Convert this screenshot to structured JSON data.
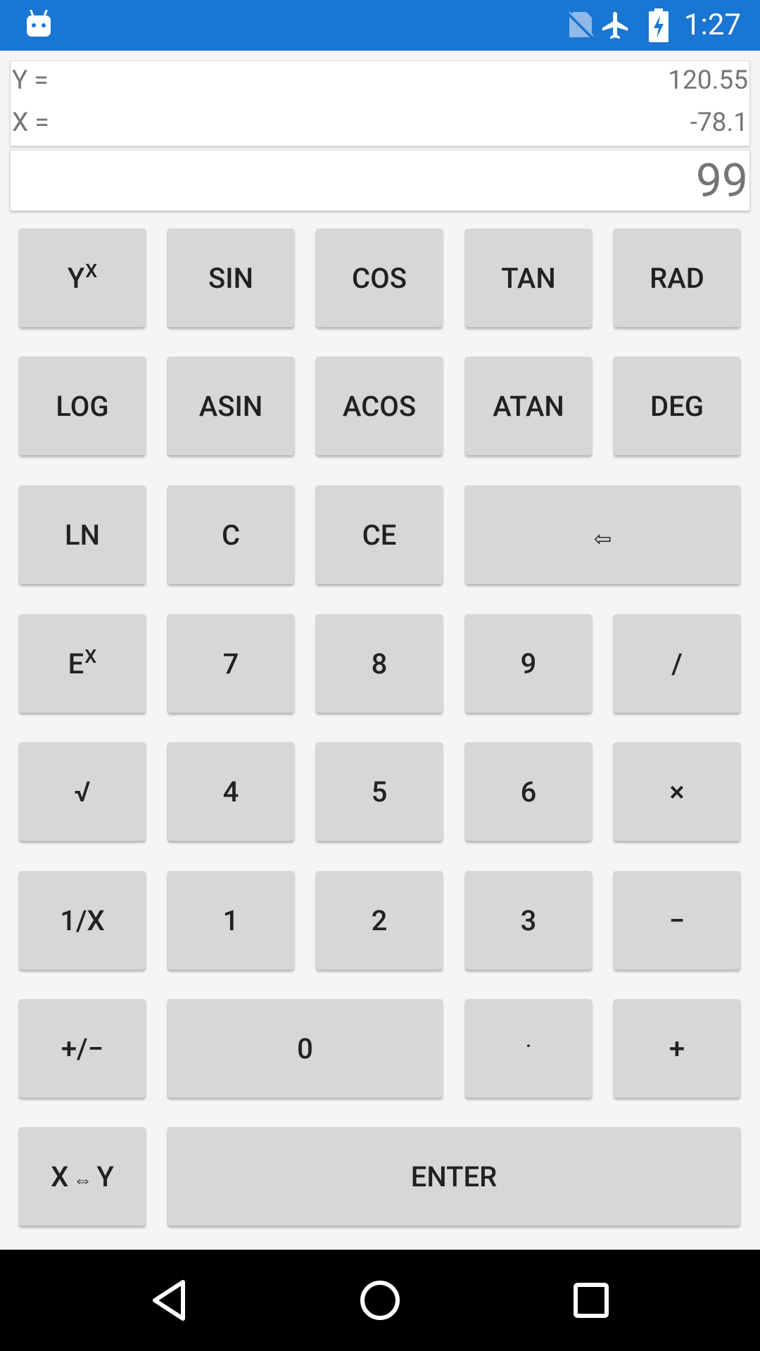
{
  "status_bar": {
    "time": "1:27",
    "icons": [
      "android-icon",
      "no-sim-icon",
      "airplane-mode-icon",
      "battery-charging-icon"
    ]
  },
  "registers": {
    "y_label": "Y =",
    "y_value": "120.55",
    "x_label": "X =",
    "x_value": "-78.1"
  },
  "display": {
    "value": "99"
  },
  "keys": {
    "pow_base": "Y",
    "pow_exp": "X",
    "sin": "SIN",
    "cos": "COS",
    "tan": "TAN",
    "rad": "RAD",
    "log": "LOG",
    "asin": "ASIN",
    "acos": "ACOS",
    "atan": "ATAN",
    "deg": "DEG",
    "ln": "LN",
    "clear": "C",
    "clear_entry": "CE",
    "backspace": "⇦",
    "exp_base": "E",
    "exp_exp": "X",
    "seven": "7",
    "eight": "8",
    "nine": "9",
    "divide": "/",
    "sqrt": "√",
    "four": "4",
    "five": "5",
    "six": "6",
    "multiply": "×",
    "reciprocal": "1/X",
    "one": "1",
    "two": "2",
    "three": "3",
    "minus": "−",
    "negate": "+/−",
    "zero": "0",
    "decimal": "·",
    "plus": "+",
    "swap_left": "X",
    "swap_arrows": "⇔",
    "swap_right": "Y",
    "enter": "ENTER"
  },
  "colors": {
    "status_bar": "#1976d2",
    "background": "#f5f5f5",
    "key": "#d6d7d7",
    "key_text": "#212121",
    "display_text": "#757575",
    "nav_bar": "#000000"
  },
  "nav_bar": {
    "icons": [
      "back-icon",
      "home-icon",
      "recents-icon"
    ]
  }
}
